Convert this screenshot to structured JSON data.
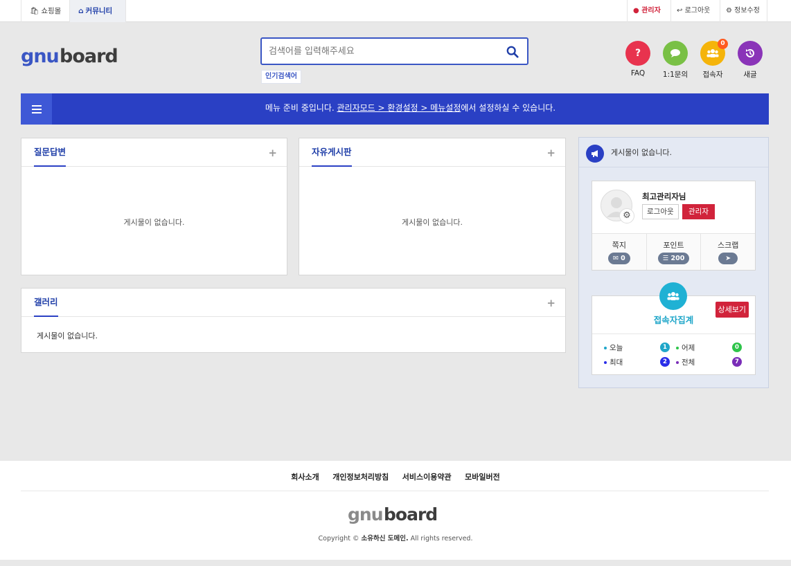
{
  "topbar": {
    "shop_tab": "쇼핑몰",
    "community_tab": "커뮤니티",
    "admin_link": "관리자",
    "logout_link": "로그아웃",
    "edit_info_link": "정보수정"
  },
  "header": {
    "logo_text_blue": "gnu",
    "logo_text_dark": "board",
    "search_placeholder": "검색어를 입력해주세요",
    "popular_label": "인기검색어",
    "quick": [
      {
        "label": "FAQ",
        "color": "#e8334e",
        "icon": "question-icon"
      },
      {
        "label": "1:1문의",
        "color": "#79c045",
        "icon": "chat-icon"
      },
      {
        "label": "접속자",
        "color": "#f5b40a",
        "icon": "users-icon",
        "badge": "0"
      },
      {
        "label": "새글",
        "color": "#8a34b8",
        "icon": "history-icon"
      }
    ]
  },
  "nav": {
    "msg_prefix": "메뉴 준비 중입니다. ",
    "msg_link": "관리자모드 > 환경설정 > 메뉴설정",
    "msg_suffix": "에서 설정하실 수 있습니다.",
    "accent": "#2a40c4"
  },
  "boards": {
    "qa": {
      "title": "질문답변",
      "empty": "게시물이 없습니다."
    },
    "free": {
      "title": "자유게시판",
      "empty": "게시물이 없습니다."
    },
    "gallery": {
      "title": "갤러리",
      "empty": "게시물이 없습니다."
    }
  },
  "sidebar": {
    "notice_text": "게시물이 없습니다.",
    "profile": {
      "nickname": "최고관리자님",
      "logout_label": "로그아웃",
      "admin_label": "관리자",
      "stats": [
        {
          "label": "쪽지",
          "value": "0",
          "icon": "envelope-icon"
        },
        {
          "label": "포인트",
          "value": "200",
          "icon": "coins-icon"
        },
        {
          "label": "스크랩",
          "value": "",
          "icon": "pin-icon"
        }
      ]
    },
    "visit": {
      "title": "접속자집계",
      "detail_label": "상세보기",
      "rows": [
        {
          "label": "오늘",
          "value": "1",
          "color": "#1fa6c9"
        },
        {
          "label": "어제",
          "value": "0",
          "color": "#2ec44a"
        },
        {
          "label": "최대",
          "value": "2",
          "color": "#2a2ee8"
        },
        {
          "label": "전체",
          "value": "7",
          "color": "#7a2db8"
        }
      ]
    }
  },
  "footer": {
    "links": [
      "회사소개",
      "개인정보처리방침",
      "서비스이용약관",
      "모바일버전"
    ],
    "logo_text_gray": "gnu",
    "logo_text_dark": "board",
    "copyright_prefix": "Copyright © ",
    "copyright_owner": "소유하신 도메인.",
    "copyright_suffix": " All rights reserved."
  }
}
